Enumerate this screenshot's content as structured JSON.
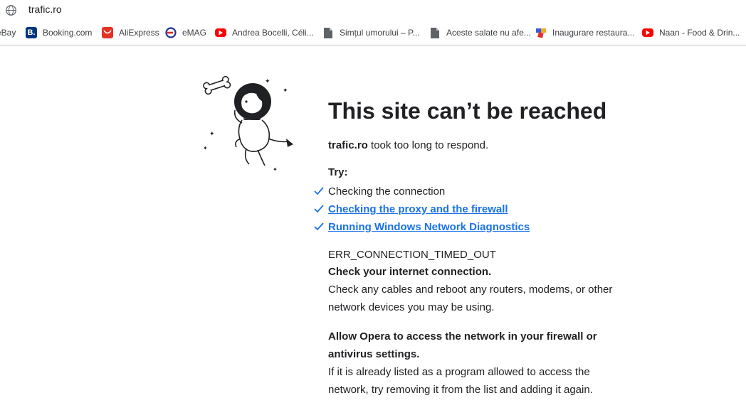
{
  "address_bar": {
    "url": "trafic.ro",
    "icon": "globe-icon"
  },
  "bookmarks": [
    {
      "label": "eBay",
      "icon": "none"
    },
    {
      "label": "Booking.com",
      "icon": "booking-icon",
      "icon_text": "B."
    },
    {
      "label": "AliExpress",
      "icon": "aliexpress-icon"
    },
    {
      "label": "eMAG",
      "icon": "emag-icon"
    },
    {
      "label": "Andrea Bocelli, Céli...",
      "icon": "youtube-icon"
    },
    {
      "label": "Simțul umorului – P...",
      "icon": "document-icon"
    },
    {
      "label": "Aceste salate nu afe...",
      "icon": "document-icon"
    },
    {
      "label": "Inaugurare restaura...",
      "icon": "puzzle-icon"
    },
    {
      "label": "Naan - Food & Drin...",
      "icon": "youtube-icon"
    }
  ],
  "error_page": {
    "title": "This site can’t be reached",
    "host": "trafic.ro",
    "host_suffix": " took too long to respond.",
    "try_label": "Try:",
    "suggestions": [
      {
        "text": "Checking the connection",
        "link": false
      },
      {
        "text": "Checking the proxy and the firewall",
        "link": true
      },
      {
        "text": "Running Windows Network Diagnostics",
        "link": true
      }
    ],
    "error_code": "ERR_CONNECTION_TIMED_OUT",
    "check_heading": "Check your internet connection.",
    "check_body": "Check any cables and reboot any routers, modems, or other network devices you may be using.",
    "firewall_heading": "Allow Opera to access the network in your firewall or antivirus settings.",
    "firewall_body": "If it is already listed as a program allowed to access the network, try removing it from the list and adding it again."
  },
  "colors": {
    "link": "#1a73e8",
    "check": "#1a73e8",
    "text": "#202124",
    "youtube": "#ff0000",
    "booking": "#003580",
    "aliexpress": "#e43225"
  }
}
